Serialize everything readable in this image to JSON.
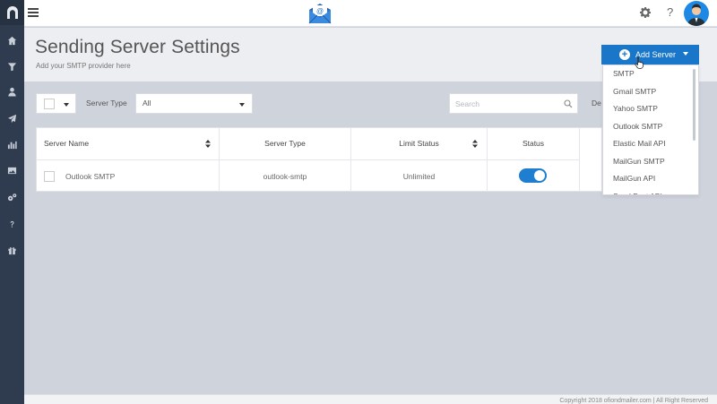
{
  "sidebar": {
    "items": [
      {
        "icon": "home-icon"
      },
      {
        "icon": "funnel-icon"
      },
      {
        "icon": "user-icon"
      },
      {
        "icon": "send-icon"
      },
      {
        "icon": "bar-chart-icon"
      },
      {
        "icon": "image-icon"
      },
      {
        "icon": "gears-icon"
      },
      {
        "icon": "question-icon"
      },
      {
        "icon": "gift-icon"
      }
    ]
  },
  "topbar": {
    "help_label": "?"
  },
  "header": {
    "title": "Sending Server Settings",
    "subtitle": "Add your SMTP provider here"
  },
  "add_server": {
    "label": "Add Server",
    "options": [
      "SMTP",
      "Gmail SMTP",
      "Yahoo SMTP",
      "Outlook SMTP",
      "Elastic Mail API",
      "MailGun SMTP",
      "MailGun API",
      "SparkPost API"
    ]
  },
  "filters": {
    "server_type_label": "Server Type",
    "server_type_value": "All",
    "search_placeholder": "Search",
    "trailing_label": "De"
  },
  "table": {
    "headers": [
      "Server Name",
      "Server Type",
      "Limit Status",
      "Status"
    ],
    "rows": [
      {
        "name": "Outlook SMTP",
        "type": "outlook-smtp",
        "limit": "Unlimited",
        "enabled": true
      }
    ]
  },
  "footer": {
    "text": "Copyright 2018 ofiondmailer.com | All Right Reserved"
  },
  "colors": {
    "accent": "#1976c8",
    "sidebar": "#2f3c4f",
    "toggle": "#1e7fd1"
  }
}
